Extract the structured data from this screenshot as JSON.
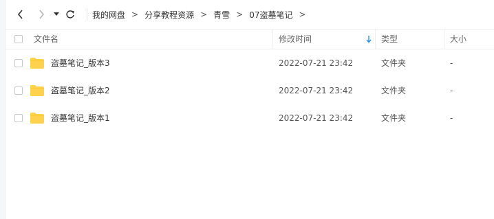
{
  "toolbar": {
    "back_icon": "chevron-left-icon",
    "forward_icon": "chevron-right-icon",
    "history_icon": "caret-down-icon",
    "refresh_icon": "refresh-icon"
  },
  "breadcrumb": {
    "items": [
      "我的网盘",
      "分享教程资源",
      "青雪",
      "07盗墓笔记"
    ],
    "separator": ">"
  },
  "table": {
    "columns": {
      "name": "文件名",
      "modified": "修改时间",
      "type": "类型",
      "size": "大小"
    },
    "sort_icon": "sort-down-arrow-icon",
    "rows": [
      {
        "name": "盗墓笔记_版本3",
        "modified": "2022-07-21 23:42",
        "type": "文件夹",
        "size": "-"
      },
      {
        "name": "盗墓笔记_版本2",
        "modified": "2022-07-21 23:42",
        "type": "文件夹",
        "size": "-"
      },
      {
        "name": "盗墓笔记_版本1",
        "modified": "2022-07-21 23:42",
        "type": "文件夹",
        "size": "-"
      }
    ]
  },
  "colors": {
    "folder": "#ffd24d",
    "sort_accent": "#2d8cf0"
  }
}
